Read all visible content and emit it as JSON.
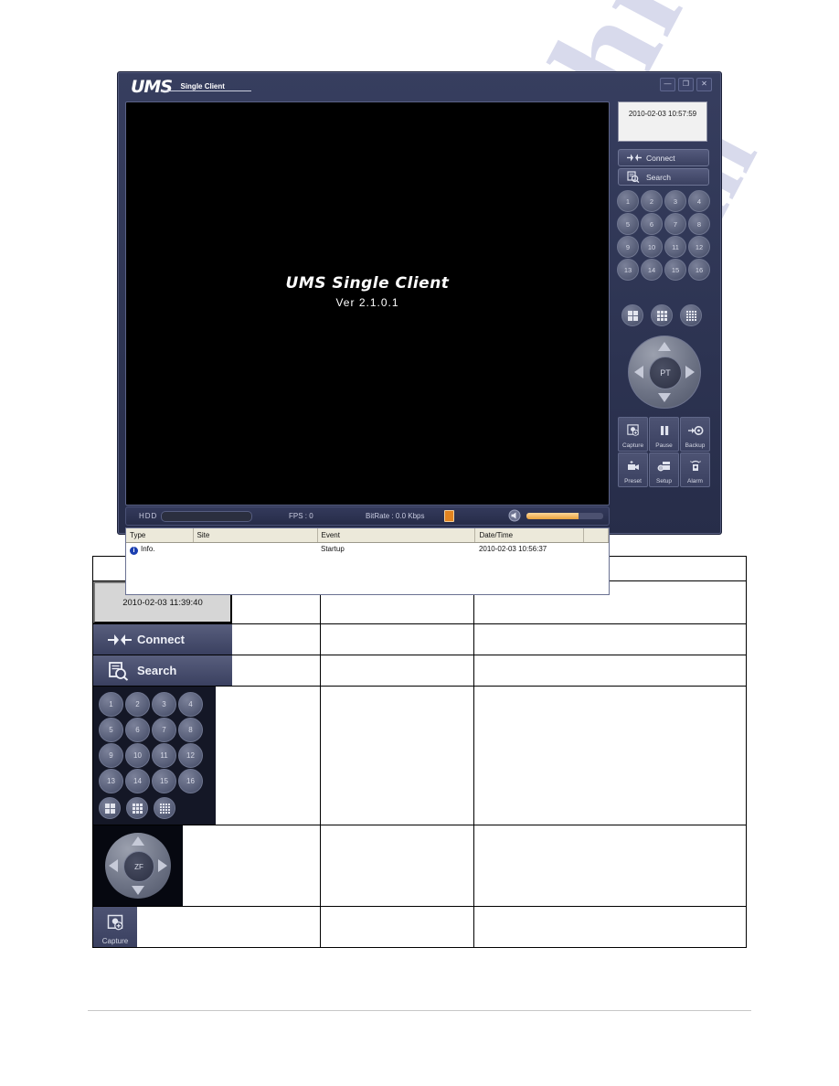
{
  "window": {
    "logo_main": "UMS",
    "logo_sub": "Single Client",
    "controls": [
      {
        "name": "minimize",
        "glyph": "—"
      },
      {
        "name": "maximize",
        "glyph": "❐"
      },
      {
        "name": "close",
        "glyph": "✕"
      }
    ]
  },
  "video": {
    "title": "UMS Single Client",
    "version": "Ver 2.1.0.1"
  },
  "statusbar": {
    "hdd_label": "HDD",
    "fps": "FPS :  0",
    "bitrate": "BitRate : 0.0 Kbps",
    "volume_percent": 68
  },
  "log": {
    "headers": [
      "Type",
      "Site",
      "Event",
      "Date/Time",
      ""
    ],
    "rows": [
      {
        "type": "Info.",
        "site": "",
        "event": "Startup",
        "datetime": "2010-02-03 10:56:37"
      }
    ]
  },
  "panel": {
    "clock": "2010-02-03 10:57:59",
    "connect_label": "Connect",
    "search_label": "Search",
    "channels": [
      "1",
      "2",
      "3",
      "4",
      "5",
      "6",
      "7",
      "8",
      "9",
      "10",
      "11",
      "12",
      "13",
      "14",
      "15",
      "16"
    ],
    "layouts": [
      "split-4",
      "split-9",
      "split-16"
    ],
    "joystick_label": "PT",
    "functions": [
      {
        "label": "Capture",
        "icon": "capture-icon"
      },
      {
        "label": "Pause",
        "icon": "pause-icon"
      },
      {
        "label": "Backup",
        "icon": "backup-icon"
      },
      {
        "label": "Preset",
        "icon": "preset-icon"
      },
      {
        "label": "Setup",
        "icon": "setup-icon"
      },
      {
        "label": "Alarm",
        "icon": "alarm-icon"
      }
    ]
  },
  "reference_table": {
    "rows": [
      {
        "item": "empty",
        "col2": "",
        "col3": ""
      },
      {
        "item": "clock",
        "clock": "2010-02-03 11:39:40",
        "col2": "",
        "col3": ""
      },
      {
        "item": "connect",
        "label": "Connect",
        "col2": "",
        "col3": ""
      },
      {
        "item": "search",
        "label": "Search",
        "col2": "",
        "col3": ""
      },
      {
        "item": "channels",
        "col2": "",
        "col3": ""
      },
      {
        "item": "joystick",
        "label": "ZF",
        "col2": "",
        "col3": ""
      },
      {
        "item": "capture",
        "label": "Capture",
        "col2": "",
        "col3": ""
      }
    ],
    "channels": [
      "1",
      "2",
      "3",
      "4",
      "5",
      "6",
      "7",
      "8",
      "9",
      "10",
      "11",
      "12",
      "13",
      "14",
      "15",
      "16"
    ]
  },
  "watermark": {
    "line1": "manualshive",
    "line2": "com"
  },
  "colors": {
    "window_bg": "#2f3655",
    "panel_button": "#4d5373",
    "accent_orange": "#e2841f",
    "info_blue": "#1b3fb0"
  }
}
